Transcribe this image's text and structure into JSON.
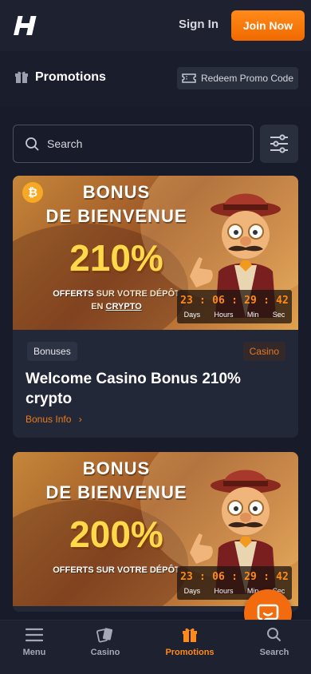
{
  "header": {
    "logo": "H",
    "signin_label": "Sign In",
    "join_label": "Join Now"
  },
  "promo_bar": {
    "title": "Promotions",
    "redeem_label": "Redeem Promo Code"
  },
  "search": {
    "placeholder": "Search"
  },
  "cards": [
    {
      "banner_line1": "BONUS",
      "banner_line2": "DE BIENVENUE",
      "banner_percent": "210%",
      "banner_offer_a": "OFFERTS",
      "banner_offer_b": "SUR VOTRE DÉPÔT",
      "banner_offer_c": "EN",
      "banner_offer_d": "CRYPTO",
      "coin_symbol": "₿",
      "countdown": {
        "days": "23",
        "hours": "06",
        "min": "29",
        "sec": "42"
      },
      "countdown_labels": {
        "days": "Days",
        "hours": "Hours",
        "min": "Min",
        "sec": "Sec"
      },
      "tag_left": "Bonuses",
      "tag_right": "Casino",
      "title": "Welcome Casino Bonus 210% crypto",
      "info_label": "Bonus Info"
    },
    {
      "banner_line1": "BONUS",
      "banner_line2": "DE BIENVENUE",
      "banner_percent": "200%",
      "banner_offer_a": "OFFERTS SUR VOTRE DÉPÔT",
      "countdown": {
        "days": "23",
        "hours": "06",
        "min": "29",
        "sec": "42"
      },
      "countdown_labels": {
        "days": "Days",
        "hours": "Hours",
        "min": "Min",
        "sec": "Sec"
      }
    }
  ],
  "nav": {
    "items": [
      {
        "label": "Menu",
        "icon": "hamburger-icon"
      },
      {
        "label": "Casino",
        "icon": "cards-icon"
      },
      {
        "label": "Promotions",
        "icon": "gift-icon",
        "active": true
      },
      {
        "label": "Search",
        "icon": "search-icon"
      }
    ]
  },
  "colors": {
    "accent": "#f07a1a",
    "background": "#181c2a",
    "card": "#232838"
  }
}
